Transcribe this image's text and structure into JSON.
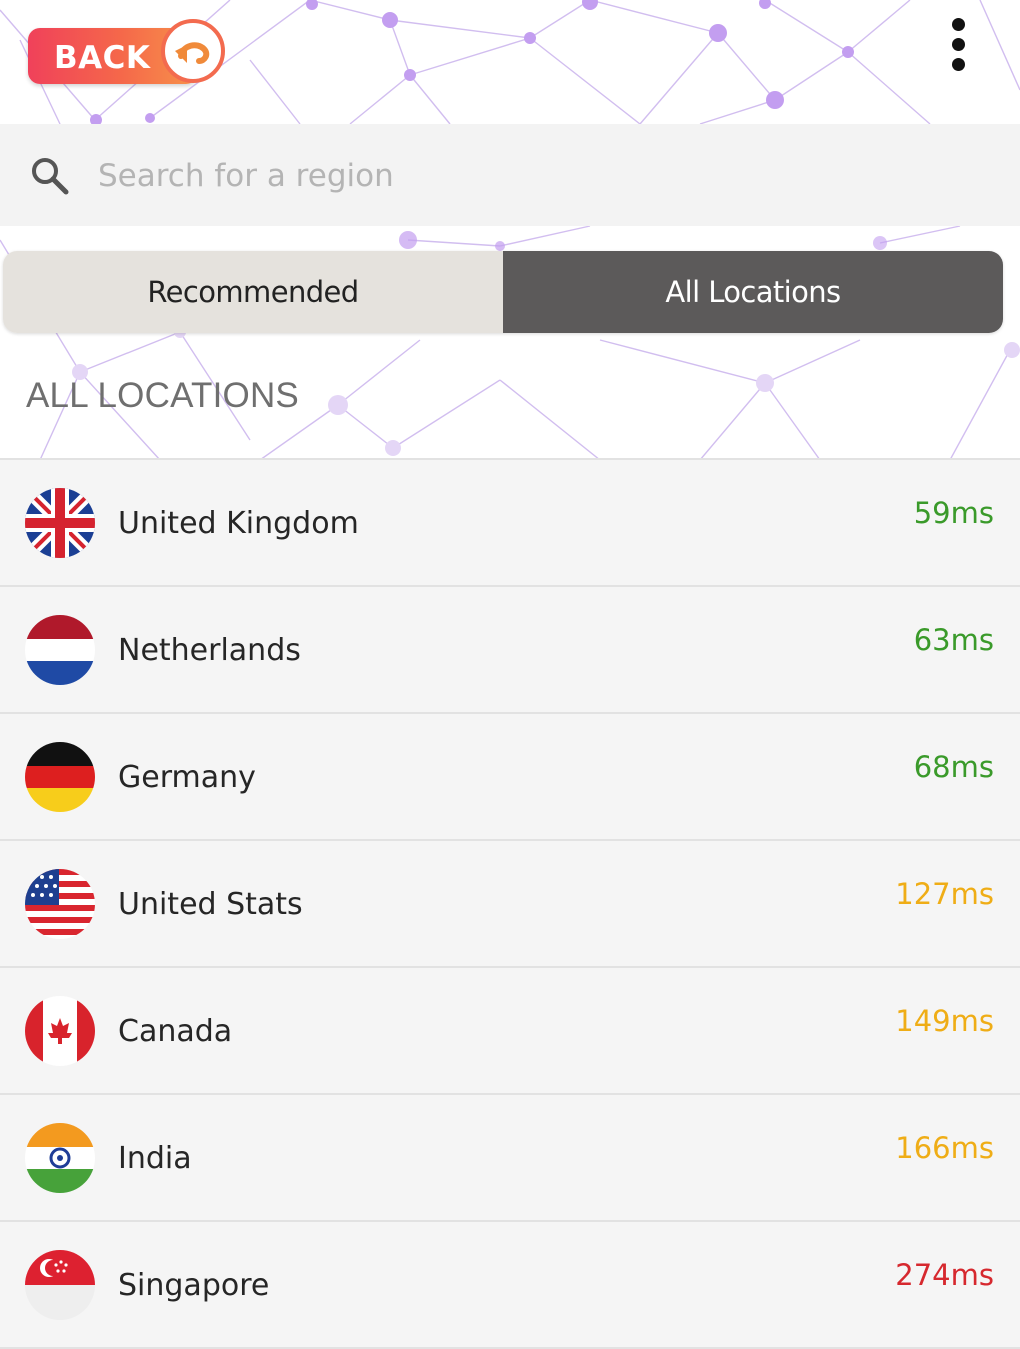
{
  "header": {
    "back_label": "BACK",
    "back_icon": "undo-arrow-icon",
    "more_icon": "vertical-dots-icon"
  },
  "search": {
    "placeholder": "Search for a region",
    "value": "",
    "icon": "search-icon"
  },
  "tabs": [
    {
      "label": "Recommended",
      "active": false
    },
    {
      "label": "All Locations",
      "active": true
    }
  ],
  "section_title": "ALL LOCATIONS",
  "colors": {
    "ping_fast": "#3a9a2a",
    "ping_medium": "#efad16",
    "ping_slow": "#d6282e",
    "tab_active_bg": "#5c5a5a",
    "tab_inactive_bg": "#e5e2dd",
    "accent": "#f36b4f"
  },
  "locations": [
    {
      "name": "United Kingdom",
      "ping": "59ms",
      "flag": "uk-flag-icon",
      "speed": "fast"
    },
    {
      "name": "Netherlands",
      "ping": "63ms",
      "flag": "netherlands-flag-icon",
      "speed": "fast"
    },
    {
      "name": "Germany",
      "ping": "68ms",
      "flag": "germany-flag-icon",
      "speed": "fast"
    },
    {
      "name": "United Stats",
      "ping": "127ms",
      "flag": "usa-flag-icon",
      "speed": "medium"
    },
    {
      "name": "Canada",
      "ping": "149ms",
      "flag": "canada-flag-icon",
      "speed": "medium"
    },
    {
      "name": "India",
      "ping": "166ms",
      "flag": "india-flag-icon",
      "speed": "medium"
    },
    {
      "name": "Singapore",
      "ping": "274ms",
      "flag": "singapore-flag-icon",
      "speed": "slow"
    }
  ]
}
